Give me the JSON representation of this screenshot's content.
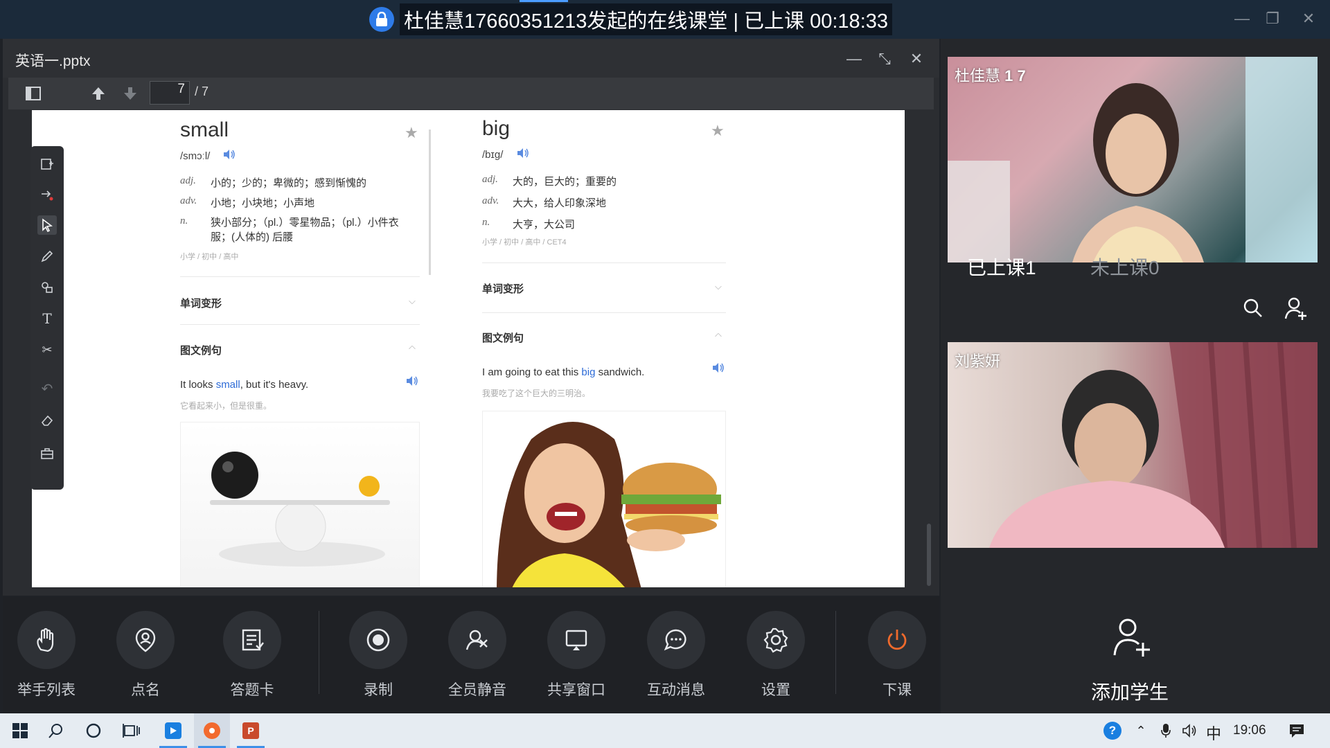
{
  "window": {
    "title": "杜佳慧17660351213发起的在线课堂 | 已上课 00:18:33",
    "controls": [
      "minimize-icon",
      "restore-icon",
      "close-icon"
    ]
  },
  "presentation": {
    "filename": "英语一.pptx",
    "current_page": "7",
    "total_pages": "/ 7"
  },
  "slide": {
    "left": {
      "word": "small",
      "phonetic": "/smɔːl/",
      "defs": [
        {
          "pos": "adj.",
          "text": "小的；少的；卑微的；感到惭愧的"
        },
        {
          "pos": "adv.",
          "text": "小地；小块地；小声地"
        },
        {
          "pos": "n.",
          "text": "狭小部分；（pl.）零星物品；（pl.）小件衣服；(人体的) 后腰"
        }
      ],
      "level": "小学 / 初中 / 高中",
      "section1": "单词变形",
      "section2": "图文例句",
      "example_pre": "It looks ",
      "example_hl": "small",
      "example_post": ", but it's heavy.",
      "example_cn": "它看起来小，但是很重。"
    },
    "right": {
      "word": "big",
      "phonetic": "/bɪɡ/",
      "defs": [
        {
          "pos": "adj.",
          "text": "大的，巨大的；重要的"
        },
        {
          "pos": "adv.",
          "text": "大大，给人印象深地"
        },
        {
          "pos": "n.",
          "text": "大亨，大公司"
        }
      ],
      "level": "小学 / 初中 / 高中 / CET4",
      "section1": "单词变形",
      "section2": "图文例句",
      "example_pre": "I am going to eat this ",
      "example_hl": "big",
      "example_post": " sandwich.",
      "example_cn": "我要吃了这个巨大的三明治。"
    }
  },
  "drawing_tools": [
    "new-page-icon",
    "laser-pointer-icon",
    "select-arrow-icon",
    "pen-icon",
    "shapes-icon",
    "text-icon",
    "scissors-icon",
    "undo-icon",
    "eraser-icon",
    "toolbox-icon"
  ],
  "controls": [
    {
      "label": "举手列表",
      "icon": "raise-hand-icon"
    },
    {
      "label": "点名",
      "icon": "roll-call-icon"
    },
    {
      "label": "答题卡",
      "icon": "answer-card-icon"
    },
    {
      "label": "录制",
      "icon": "record-icon"
    },
    {
      "label": "全员静音",
      "icon": "mute-all-icon"
    },
    {
      "label": "共享窗口",
      "icon": "share-window-icon"
    },
    {
      "label": "互动消息",
      "icon": "chat-icon"
    },
    {
      "label": "设置",
      "icon": "settings-icon"
    },
    {
      "label": "下课",
      "icon": "power-icon"
    }
  ],
  "participants": {
    "teacher_name": "杜佳慧",
    "teacher_suffix": "1 7",
    "student_name": "刘紫妍",
    "tab_in_class": "已上课1",
    "tab_not_in_class": "未上课0",
    "add_student": "添加学生"
  },
  "taskbar": {
    "clock": "19:06",
    "ime": "中"
  }
}
